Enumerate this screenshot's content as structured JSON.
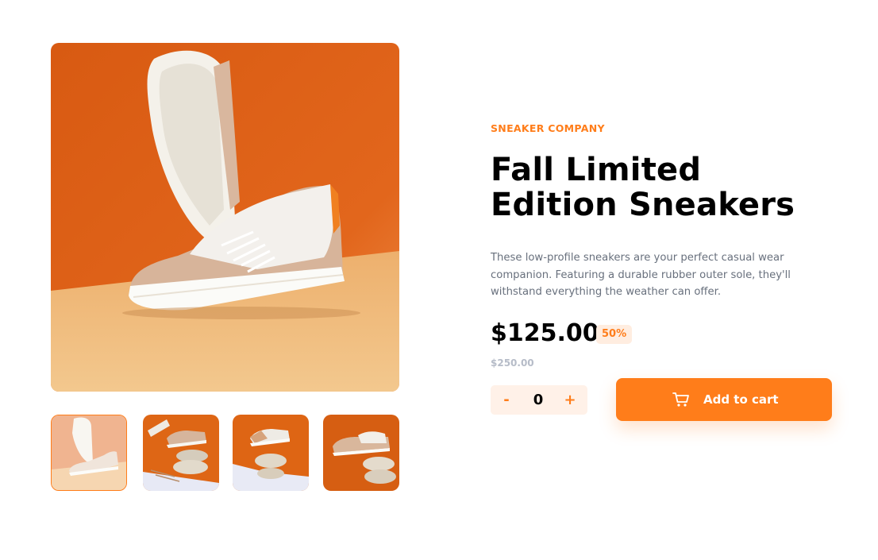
{
  "product": {
    "company": "SNEAKER COMPANY",
    "title": "Fall Limited Edition Sneakers",
    "description": "These low-profile sneakers are your perfect casual wear companion. Featuring a durable rubber outer sole, they'll withstand everything the weather can offer.",
    "price": "$125.00",
    "discount": "50%",
    "original_price": "$250.00"
  },
  "quantity": {
    "minus_label": "-",
    "value": "0",
    "plus_label": "+"
  },
  "cart_button": {
    "label": "Add to cart",
    "icon": "cart-icon"
  },
  "gallery": {
    "thumbnails": [
      "thumbnail-1",
      "thumbnail-2",
      "thumbnail-3",
      "thumbnail-4"
    ],
    "active_index": 0
  },
  "colors": {
    "accent": "#ff7d1a",
    "accent_light": "#ffede0",
    "text_dark": "#000000",
    "text_muted": "#68707d",
    "text_light": "#b6bcc8"
  }
}
